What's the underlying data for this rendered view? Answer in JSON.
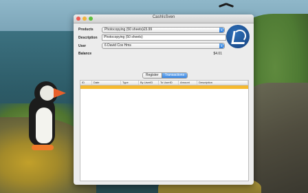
{
  "window": {
    "title": "CashIsSven"
  },
  "form": {
    "products_label": "Products",
    "products_value": "Photocopying (50 sheets)£5.99",
    "description_label": "Description",
    "description_value": "Photocopying (50 sheets)",
    "user_label": "User",
    "user_value": "6 David Cox Hms",
    "balance_label": "Balance",
    "balance_value": "$4.01"
  },
  "tabs": [
    {
      "label": "Register",
      "selected": false
    },
    {
      "label": "Transactions",
      "selected": true
    }
  ],
  "table": {
    "columns": [
      "ID",
      "Date",
      "Type",
      "By UserID",
      "To UserID",
      "Amount",
      "Description"
    ],
    "rows": [
      [
        "",
        "",
        "",
        "",
        "",
        "",
        ""
      ]
    ],
    "selected_row_color": "#f5b92e"
  },
  "colors": {
    "accent": "#3a86e0",
    "logo": "#1d4f8f"
  }
}
